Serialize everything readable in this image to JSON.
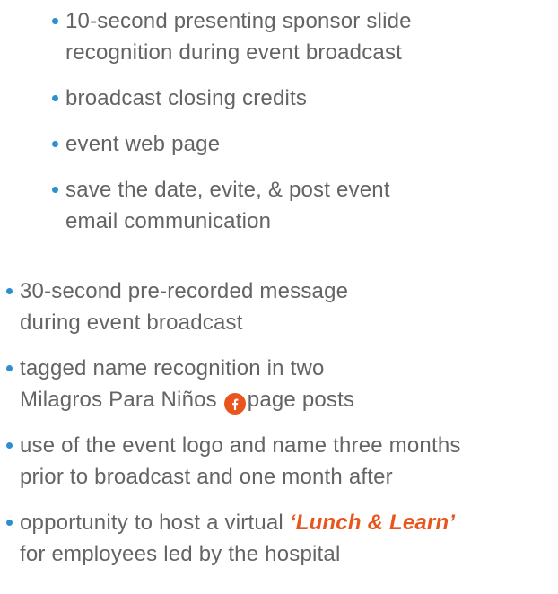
{
  "nested_list": [
    {
      "line1": "10-second presenting sponsor slide",
      "line2": "recognition during event broadcast"
    },
    {
      "line1": "broadcast closing credits"
    },
    {
      "line1": "event web page"
    },
    {
      "line1": "save the date, evite, & post event",
      "line2": "email communication"
    }
  ],
  "outer_list": {
    "item1": {
      "line1": "30-second pre-recorded message",
      "line2": "during event broadcast"
    },
    "item2": {
      "line1": "tagged name recognition in two",
      "line2_before": "Milagros Para Niños",
      "line2_after": "page posts",
      "icon": "facebook-icon"
    },
    "item3": {
      "line1": "use of the event logo and name three months",
      "line2": "prior to broadcast and one month after"
    },
    "item4": {
      "line1_prefix": "opportunity to host a virtual ",
      "emphasis": "‘Lunch & Learn’",
      "line2": "for employees led by the hospital"
    }
  },
  "colors": {
    "text": "#646464",
    "bullet": "#2d8fd0",
    "accent": "#e8561d"
  }
}
